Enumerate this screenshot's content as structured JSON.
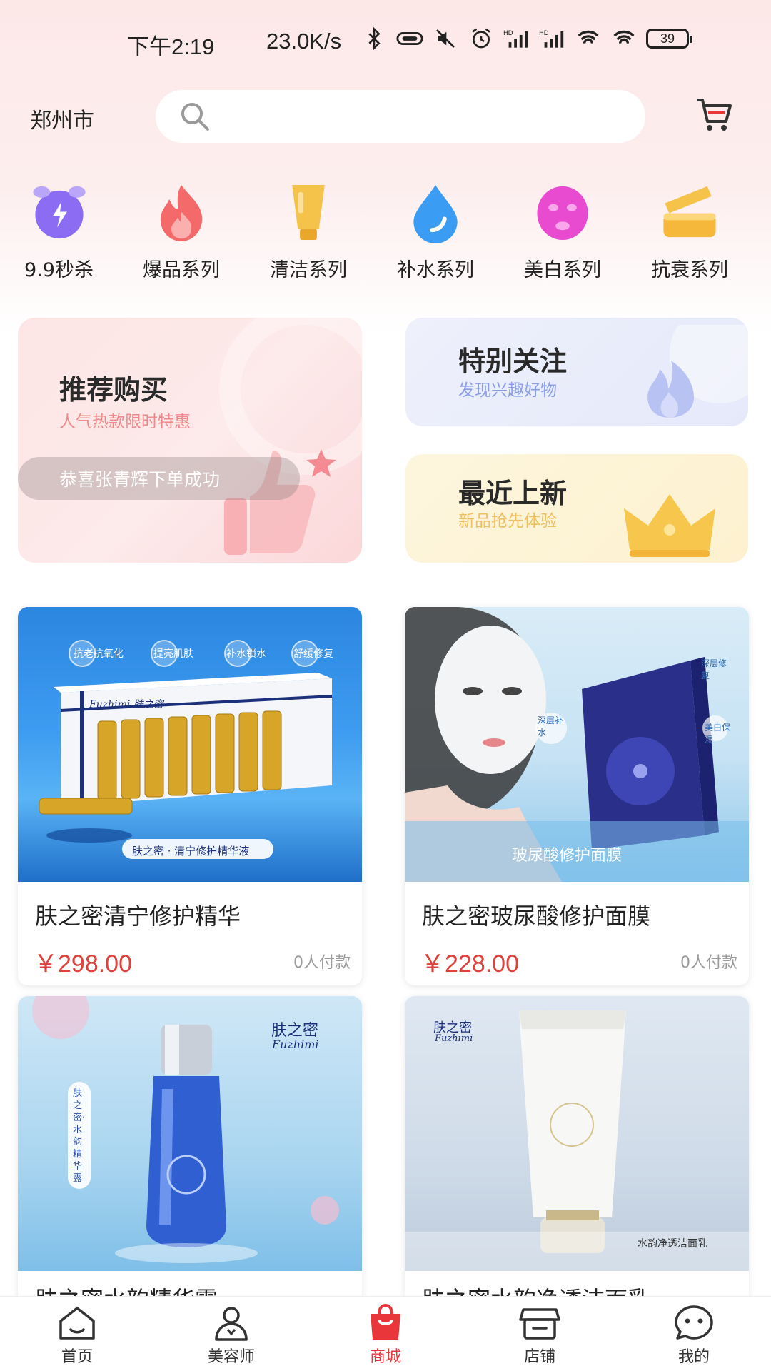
{
  "status_bar": {
    "time": "下午2:19",
    "speed": "23.0K/s",
    "battery": "39",
    "icons": [
      "bluetooth-icon",
      "nfc-icon",
      "mute-icon",
      "alarm-icon",
      "hd-signal-icon",
      "hd-signal-icon",
      "wifi-icon",
      "wifi-icon",
      "battery-icon"
    ]
  },
  "header": {
    "city": "郑州市",
    "search_placeholder": "",
    "cart_icon": "cart-icon"
  },
  "categories": [
    {
      "label": "9.9秒杀",
      "icon": "alarm-clock-icon",
      "color": "#8b6cf2"
    },
    {
      "label": "爆品系列",
      "icon": "flame-icon",
      "color": "#f46a6a"
    },
    {
      "label": "清洁系列",
      "icon": "tube-icon",
      "color": "#f5b83a"
    },
    {
      "label": "补水系列",
      "icon": "water-drop-icon",
      "color": "#3a9cf2"
    },
    {
      "label": "美白系列",
      "icon": "face-mask-icon",
      "color": "#e84bd0"
    },
    {
      "label": "抗衰系列",
      "icon": "cream-jar-icon",
      "color": "#f5b83a"
    }
  ],
  "promos": {
    "recommend": {
      "title": "推荐购买",
      "subtitle": "人气热款限时特惠",
      "toast": "恭喜张青辉下单成功"
    },
    "attention": {
      "title": "特别关注",
      "subtitle": "发现兴趣好物"
    },
    "new": {
      "title": "最近上新",
      "subtitle": "新品抢先体验"
    }
  },
  "products": [
    {
      "name": "肤之密清宁修护精华",
      "price": "￥298.00",
      "sold": "0人付款",
      "image_caption": "肤之密 · 清宁修护精华液",
      "tags": [
        "抗老抗氧化",
        "提亮肌肤",
        "补水锁水",
        "舒缓修复"
      ],
      "brand": "Fuzhimi 肤之密"
    },
    {
      "name": "肤之密玻尿酸修护面膜",
      "price": "￥228.00",
      "sold": "0人付款",
      "image_caption": "玻尿酸修护面膜",
      "tags": [
        "深层补水",
        "深层修复",
        "美白保湿"
      ]
    },
    {
      "name": "肤之密水韵精华露",
      "brand": "肤之密",
      "brand_en": "Fuzhimi",
      "side_text": "肤之密·水韵精华露"
    },
    {
      "name": "肤之密水韵净透洁面乳",
      "brand": "肤之密",
      "brand_en": "Fuzhimi",
      "image_caption": "水韵净透洁面乳"
    }
  ],
  "bottom_nav": [
    {
      "label": "首页",
      "icon": "home-icon",
      "active": false
    },
    {
      "label": "美容师",
      "icon": "beautician-icon",
      "active": false
    },
    {
      "label": "商城",
      "icon": "shopping-bag-icon",
      "active": true
    },
    {
      "label": "店铺",
      "icon": "store-icon",
      "active": false
    },
    {
      "label": "我的",
      "icon": "profile-icon",
      "active": false
    }
  ],
  "colors": {
    "accent": "#e8363a",
    "price": "#e0413b",
    "promo_sub_red": "#f08a8a",
    "promo_sub_blue": "#8a9ee8",
    "promo_sub_gold": "#f0c060"
  }
}
